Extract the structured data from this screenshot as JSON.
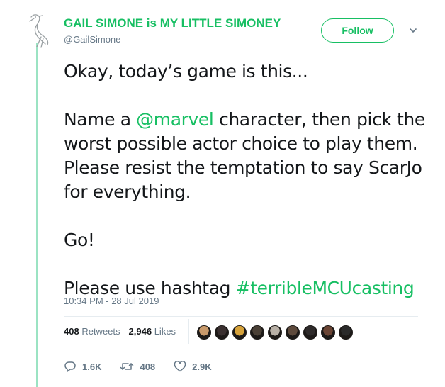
{
  "author": {
    "display_name": "GAIL SIMONE is MY LITTLE SIMONEY",
    "handle": "@GailSimone"
  },
  "follow_label": "Follow",
  "tweet": {
    "line1": "Okay, today’s game is this...",
    "para2_prefix": "Name a ",
    "mention": "@marvel",
    "para2_suffix": " character, then pick the worst possible actor choice to play them. Please resist the temptation to say ScarJo for everything.",
    "line3": "Go!",
    "para4_prefix": "Please use hashtag ",
    "hashtag": "#terribleMCUcasting"
  },
  "timestamp": "10:34 PM - 28 Jul 2019",
  "stats": {
    "retweets_count": "408",
    "retweets_label": "Retweets",
    "likes_count": "2,946",
    "likes_label": "Likes"
  },
  "likers": [
    {
      "color": "#c99a6b"
    },
    {
      "color": "#3a3030"
    },
    {
      "color": "#d6a23a"
    },
    {
      "color": "#4a4036"
    },
    {
      "color": "#b8b0a6"
    },
    {
      "color": "#5e4a3c"
    },
    {
      "color": "#2e2a2a"
    },
    {
      "color": "#6a4434"
    },
    {
      "color": "#2a2a2a"
    }
  ],
  "actions": {
    "replies": "1.6K",
    "retweets": "408",
    "likes": "2.9K"
  },
  "colors": {
    "accent": "#17bf63",
    "thread_line": "#9be3c3",
    "muted": "#657786"
  },
  "icons": [
    "bird-avatar-icon",
    "chevron-down-icon",
    "reply-icon",
    "retweet-icon",
    "like-icon"
  ]
}
